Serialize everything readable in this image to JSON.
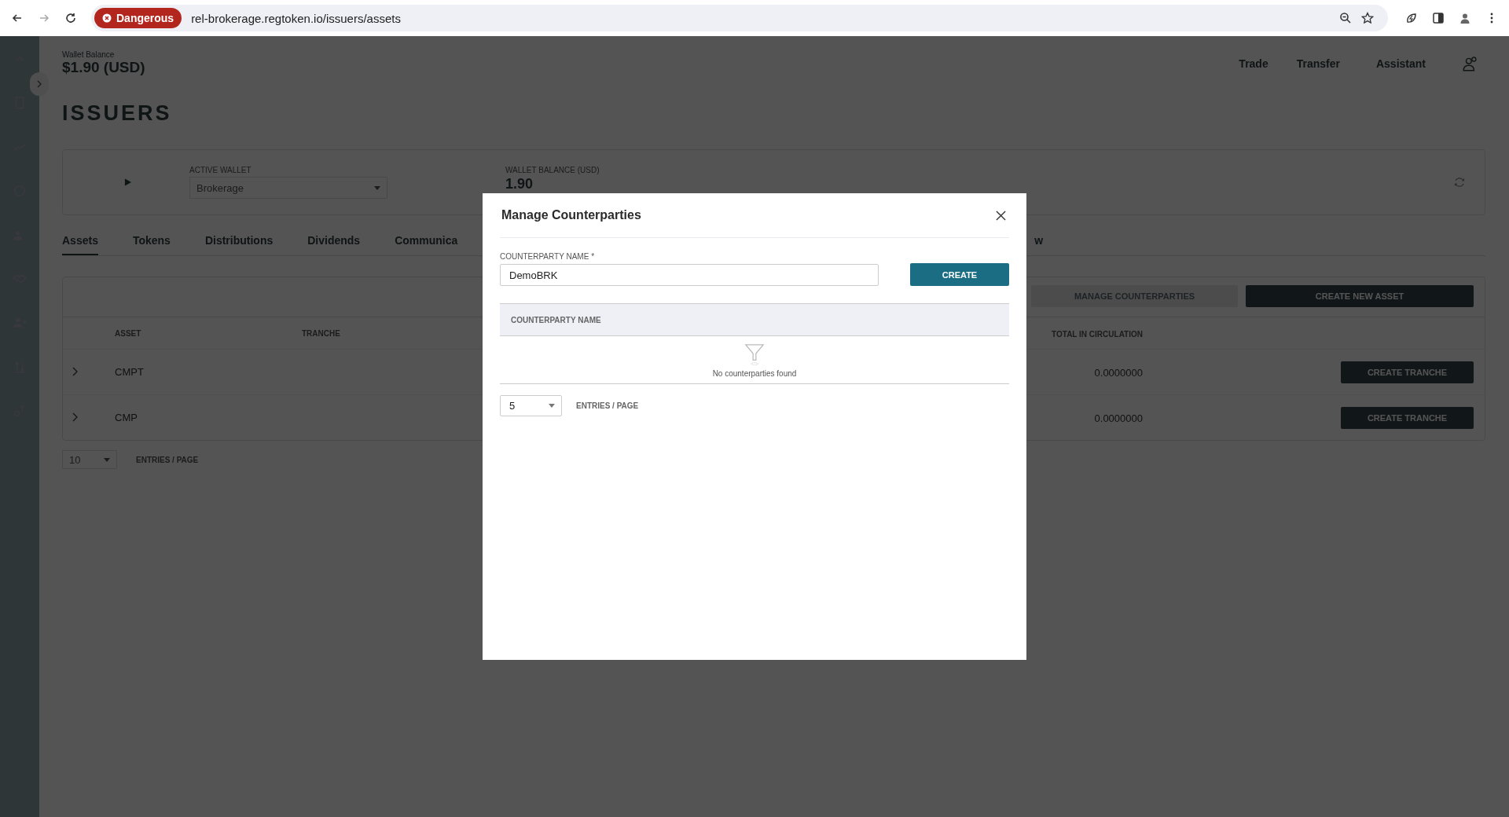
{
  "browser": {
    "security_badge": "Dangerous",
    "url": "rel-brokerage.regtoken.io/issuers/assets"
  },
  "header": {
    "balance_label": "Wallet Balance",
    "balance": "$1.90 (USD)",
    "nav": [
      "Trade",
      "Transfer",
      "Assistant"
    ]
  },
  "page_title": "ISSUERS",
  "wallet_card": {
    "active_wallet_label": "ACTIVE WALLET",
    "active_wallet": "Brokerage",
    "balance_label": "WALLET BALANCE (USD)",
    "balance": "1.90"
  },
  "tabs": [
    {
      "label": "Assets",
      "selected": true
    },
    {
      "label": "Tokens",
      "selected": false
    },
    {
      "label": "Distributions",
      "selected": false
    },
    {
      "label": "Dividends",
      "selected": false
    },
    {
      "label": "Communica",
      "selected": false
    },
    {
      "label": "w",
      "selected": false
    }
  ],
  "toolbar": {
    "buttons": [
      {
        "label": "MANAGE COUNTERPARTIES",
        "disabled": true
      },
      {
        "label": "CREATE NEW ASSET",
        "disabled": false
      }
    ]
  },
  "assets_table": {
    "columns": [
      "ASSET",
      "TRANCHE",
      "TOTAL IN CIRCULATION"
    ],
    "rows": [
      {
        "asset": "CMPT",
        "total": "0.0000000",
        "action": "CREATE TRANCHE"
      },
      {
        "asset": "CMP",
        "total": "0.0000000",
        "action": "CREATE TRANCHE"
      }
    ],
    "page_size": "10",
    "page_size_label": "ENTRIES / PAGE"
  },
  "modal": {
    "title": "Manage Counterparties",
    "field_label": "COUNTERPARTY NAME *",
    "field_value": "DemoBRK",
    "create_button": "CREATE",
    "table": {
      "columns": [
        "COUNTERPARTY NAME"
      ],
      "empty_text": "No counterparties found"
    },
    "page_size": "5",
    "page_size_label": "ENTRIES / PAGE"
  }
}
